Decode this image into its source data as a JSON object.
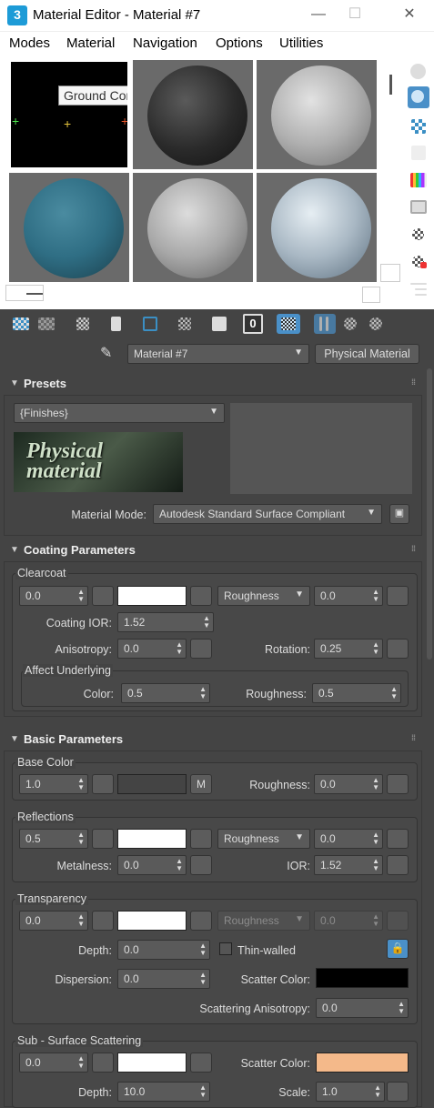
{
  "window": {
    "title": "Material Editor - Material #7",
    "logo": "3",
    "minimize": "—",
    "maximize": "☐",
    "close": "✕"
  },
  "menu": [
    "Modes",
    "Material",
    "Navigation",
    "Options",
    "Utilities"
  ],
  "slots": {
    "tooltip": "Ground Concrete",
    "colors": [
      "#000000",
      "#2a2a2a",
      "#b8b8b8",
      "#2f6e84",
      "#a8a8a8",
      "#a9b8c4"
    ]
  },
  "toolbar": {
    "slot_number": "0",
    "material_name": "Material #7",
    "material_type": "Physical Material"
  },
  "presets": {
    "title": "Presets",
    "preset": "{Finishes}",
    "thumb_text": "Physical material",
    "mode_label": "Material Mode:",
    "mode_value": "Autodesk Standard Surface Compliant"
  },
  "coating": {
    "title": "Coating Parameters",
    "group": "Clearcoat",
    "weight": "0.0",
    "rough_mode": "Roughness",
    "rough_value": "0.0",
    "ior_label": "Coating IOR:",
    "ior": "1.52",
    "aniso_label": "Anisotropy:",
    "aniso": "0.0",
    "rot_label": "Rotation:",
    "rot": "0.25",
    "affect_group": "Affect Underlying",
    "color_label": "Color:",
    "color": "0.5",
    "aroughness_label": "Roughness:",
    "aroughness": "0.5"
  },
  "basic": {
    "title": "Basic Parameters",
    "base_group": "Base Color",
    "base_weight": "1.0",
    "map_btn": "M",
    "base_rough_label": "Roughness:",
    "base_rough": "0.0",
    "refl_group": "Reflections",
    "refl_weight": "0.5",
    "refl_mode": "Roughness",
    "refl_rough": "0.0",
    "metal_label": "Metalness:",
    "metal": "0.0",
    "ior_label": "IOR:",
    "ior": "1.52",
    "trans_group": "Transparency",
    "trans_weight": "0.0",
    "trans_mode": "Roughness",
    "trans_rough": "0.0",
    "depth_label": "Depth:",
    "depth": "0.0",
    "thin_label": "Thin-walled",
    "disp_label": "Dispersion:",
    "disp": "0.0",
    "scatter_color_label": "Scatter Color:",
    "scat_aniso_label": "Scattering Anisotropy:",
    "scat_aniso": "0.0",
    "sss_group": "Sub - Surface Scattering",
    "sss_weight": "0.0",
    "sss_scatter_label": "Scatter Color:",
    "sss_depth_label": "Depth:",
    "sss_depth": "10.0",
    "scale_label": "Scale:",
    "scale": "1.0"
  },
  "colors": {
    "sss_scatter": "#f4b98a",
    "trans_scatter": "#000000",
    "base": "#444444"
  }
}
